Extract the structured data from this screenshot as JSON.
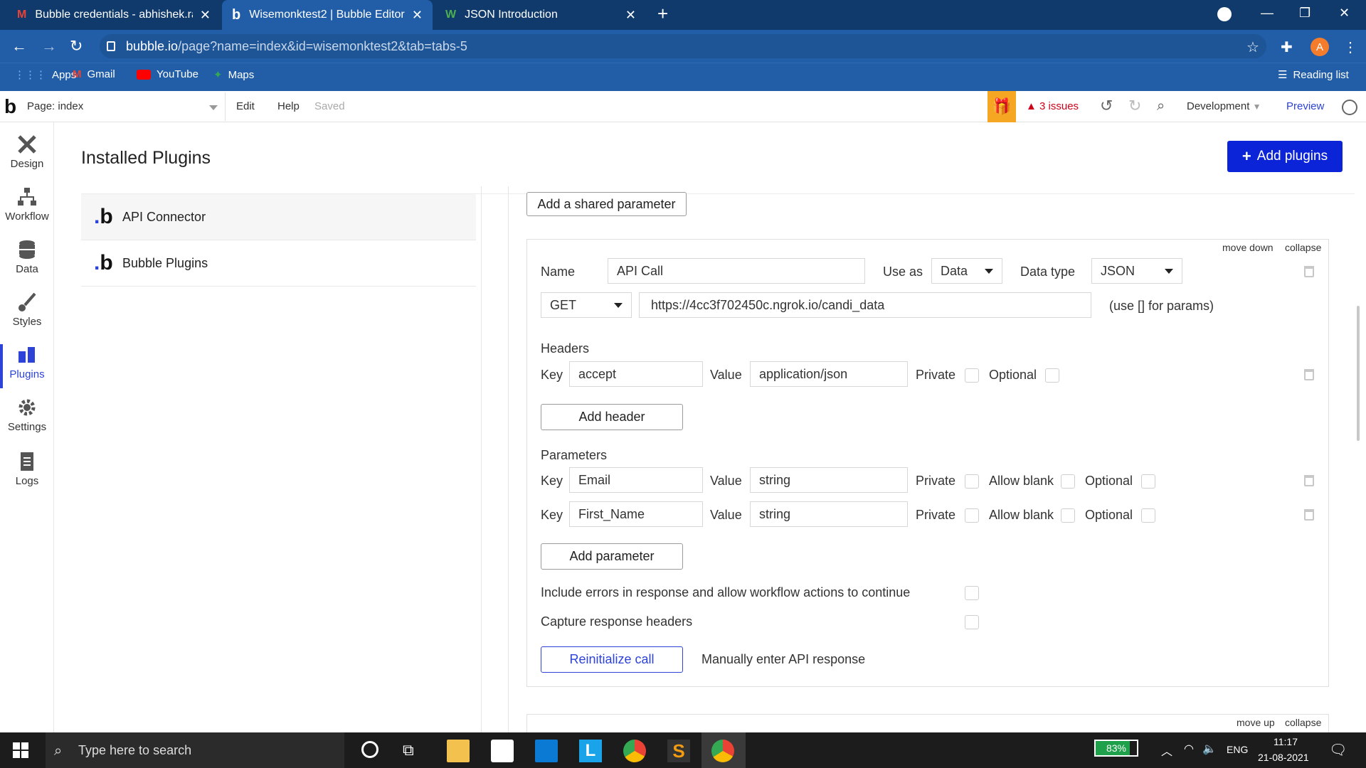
{
  "browser": {
    "tabs": [
      {
        "title": "Bubble credentials - abhishek.ran",
        "icon": "gmail-icon"
      },
      {
        "title": "Wisemonktest2 | Bubble Editor",
        "icon": "bubble-icon"
      },
      {
        "title": "JSON Introduction",
        "icon": "w3schools-icon"
      }
    ],
    "url_host": "bubble.io",
    "url_path": "/page?name=index&id=wisemonktest2&tab=tabs-5",
    "profile_initial": "A",
    "bookmarks": [
      "Apps",
      "Gmail",
      "YouTube",
      "Maps"
    ],
    "reading_list": "Reading list"
  },
  "editor": {
    "page_label": "Page: index",
    "menu": [
      "Edit",
      "Help"
    ],
    "saved": "Saved",
    "issues": "3 issues",
    "env": "Development",
    "preview": "Preview"
  },
  "rail": [
    "Design",
    "Workflow",
    "Data",
    "Styles",
    "Plugins",
    "Settings",
    "Logs"
  ],
  "plugins": {
    "title": "Installed Plugins",
    "add_button": "Add plugins",
    "items": [
      "API Connector",
      "Bubble Plugins"
    ]
  },
  "api": {
    "shared_param_button": "Add a shared parameter",
    "move_down": "move down",
    "collapse": "collapse",
    "name_label": "Name",
    "name_value": "API Call",
    "use_as_label": "Use as",
    "use_as_value": "Data",
    "data_type_label": "Data type",
    "data_type_value": "JSON",
    "method": "GET",
    "endpoint": "https://4cc3f702450c.ngrok.io/candi_data",
    "params_hint": "(use [] for params)",
    "headers_title": "Headers",
    "key_label": "Key",
    "value_label": "Value",
    "private_label": "Private",
    "optional_label": "Optional",
    "allow_blank_label": "Allow blank",
    "header_key": "accept",
    "header_value": "application/json",
    "add_header": "Add header",
    "parameters_title": "Parameters",
    "params": [
      {
        "key": "Email",
        "value": "string"
      },
      {
        "key": "First_Name",
        "value": "string"
      }
    ],
    "add_parameter": "Add parameter",
    "include_errors": "Include errors in response and allow workflow actions to continue",
    "capture_headers": "Capture response headers",
    "reinit": "Reinitialize call",
    "manual": "Manually enter API response",
    "move_up": "move up"
  },
  "taskbar": {
    "search_placeholder": "Type here to search",
    "battery": "83%",
    "lang": "ENG",
    "time": "11:17",
    "date": "21-08-2021"
  }
}
